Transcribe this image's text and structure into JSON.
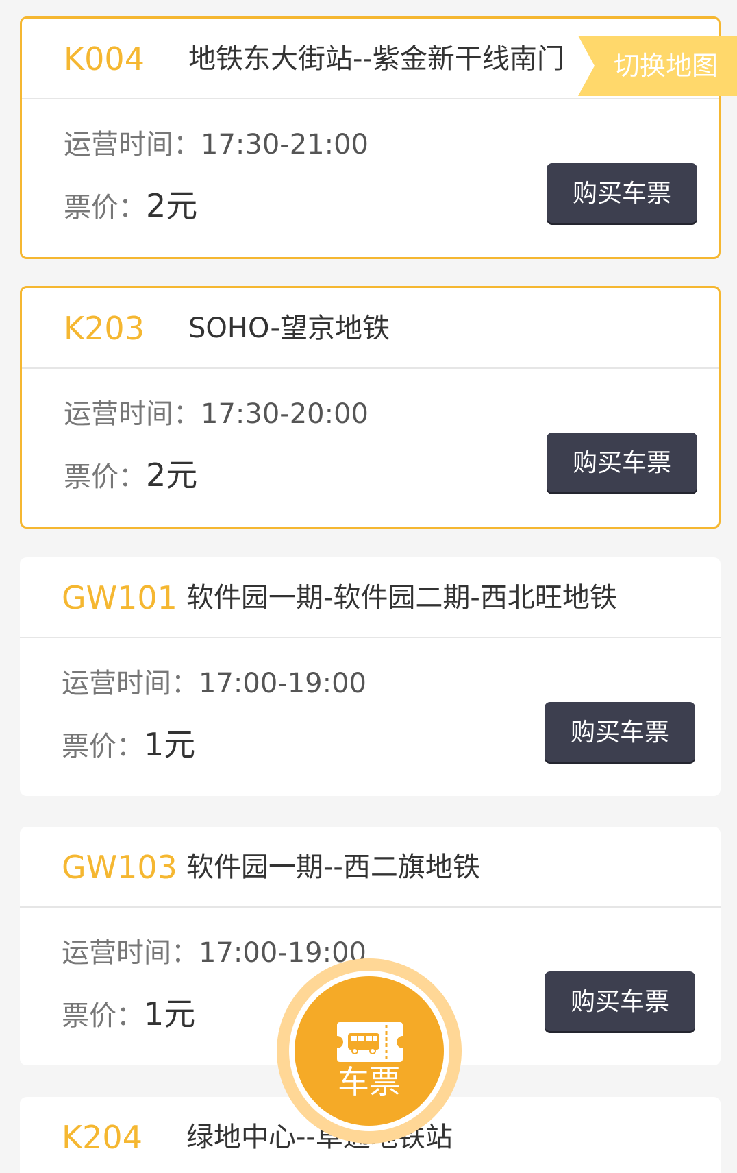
{
  "map_switch_label": "切换地图",
  "hours_label": "运营时间：",
  "fare_label": "票价：",
  "buy_label": "购买车票",
  "routes": [
    {
      "code": "K004",
      "name": "地铁东大街站--紫金新干线南门",
      "hours": "17:30-21:00",
      "fare": "2元",
      "highlighted": true
    },
    {
      "code": "K203",
      "name": "SOHO-望京地铁",
      "hours": "17:30-20:00",
      "fare": "2元",
      "highlighted": true
    },
    {
      "code": "GW101",
      "name": "软件园一期-软件园二期-西北旺地铁",
      "hours": "17:00-19:00",
      "fare": "1元",
      "highlighted": false
    },
    {
      "code": "GW103",
      "name": "软件园一期--西二旗地铁",
      "hours": "17:00-19:00",
      "fare": "1元",
      "highlighted": false
    },
    {
      "code": "K204",
      "name": "绿地中心--阜通地铁站",
      "hours": "",
      "fare": "",
      "highlighted": false
    }
  ],
  "fab": {
    "label": "车票",
    "icon": "bus-ticket-icon"
  },
  "colors": {
    "accent": "#f5b731",
    "button": "#3d3f4f",
    "fab": "#f5aa27",
    "background": "#f5f5f5"
  }
}
